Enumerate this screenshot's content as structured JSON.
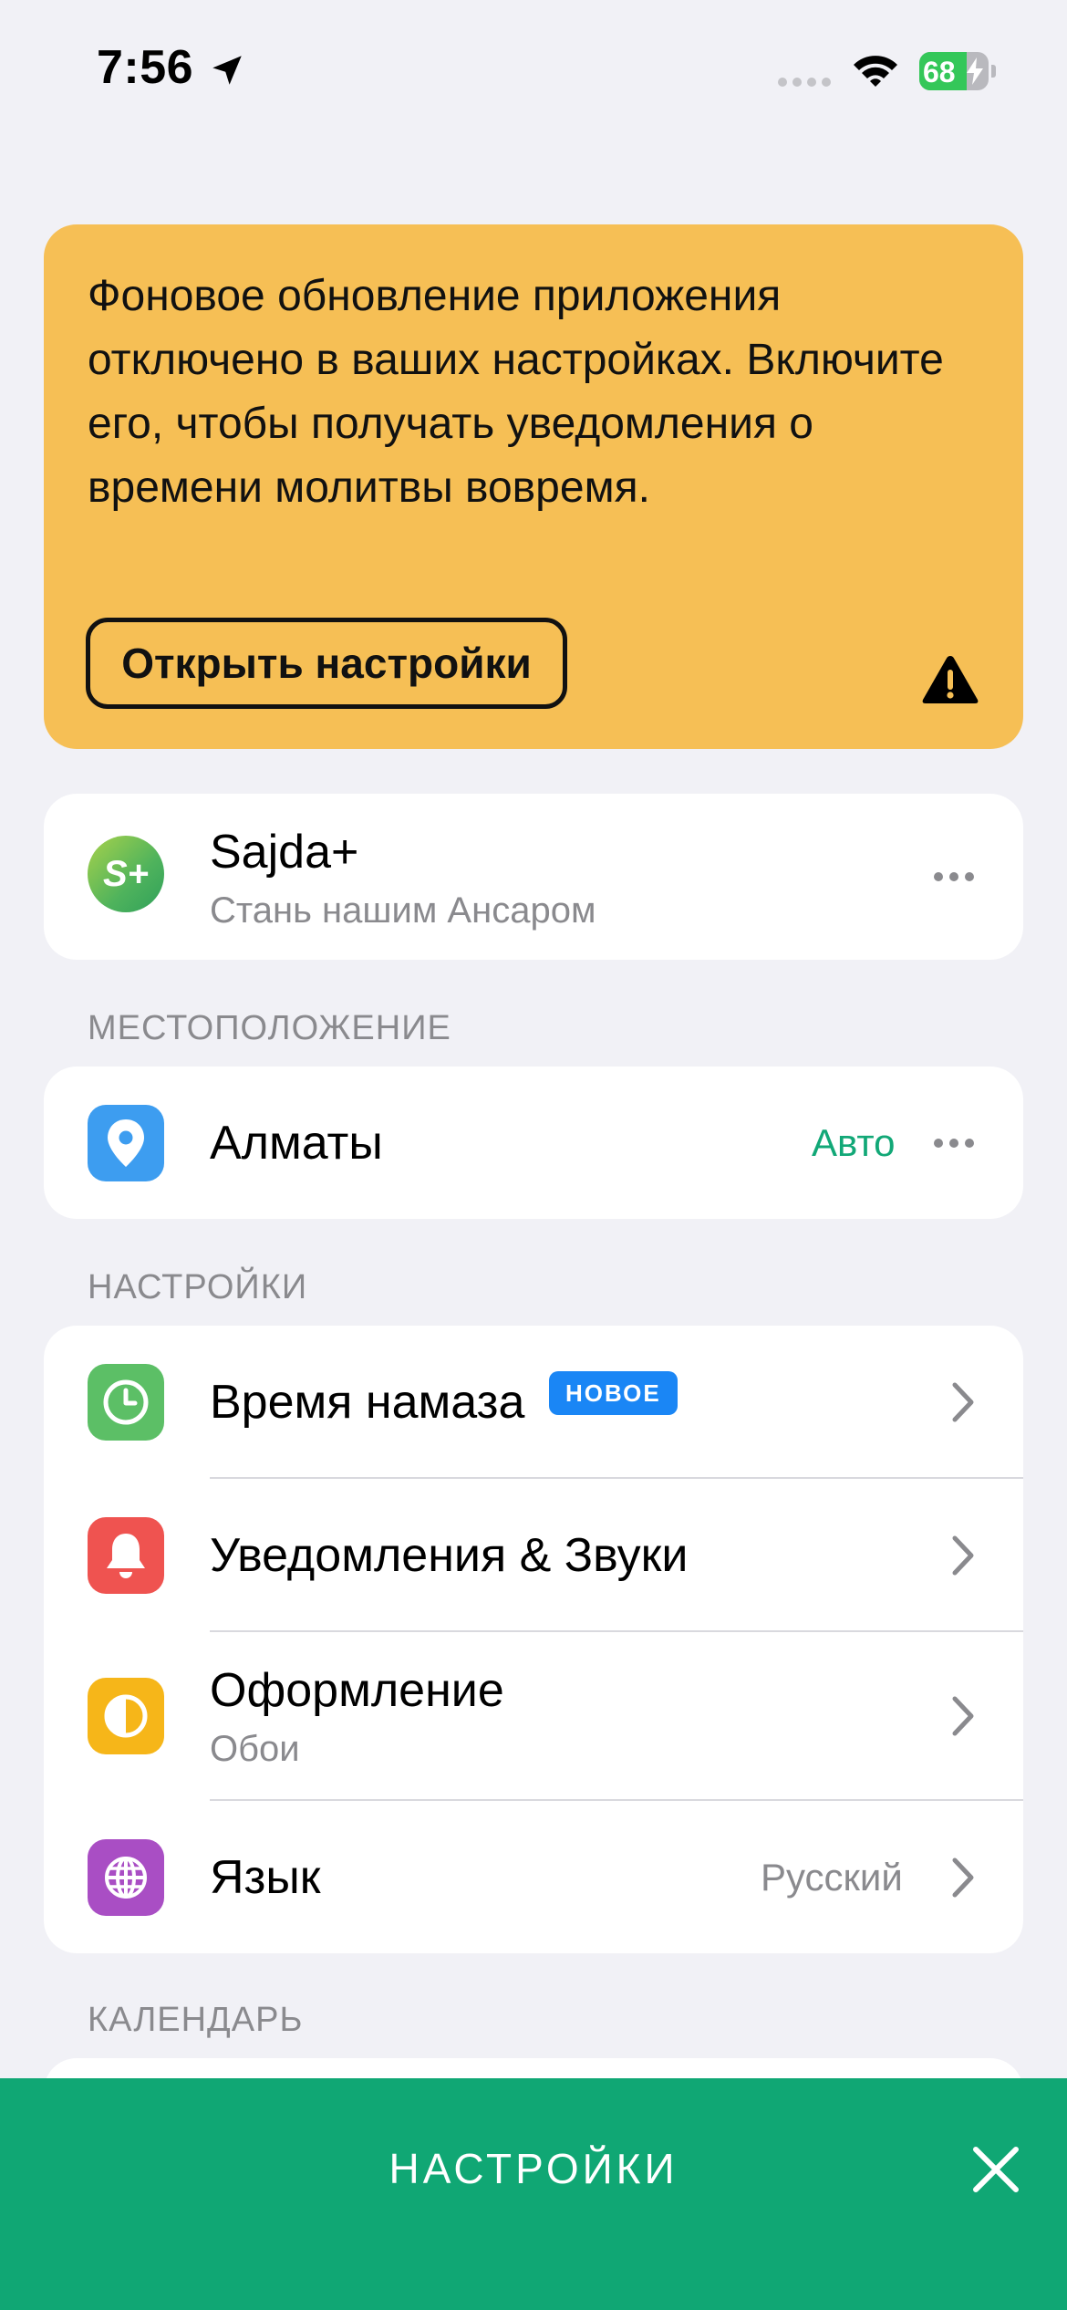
{
  "status_bar": {
    "time": "7:56",
    "battery": "68",
    "battery_level": 0.68
  },
  "warning": {
    "message": "Фоновое обновление приложения отключено в ваших настройках. Включите его, чтобы получать уведомления о времени молитвы вовремя.",
    "button_label": "Открыть настройки",
    "color": "#f6bf55",
    "icon": "warning-icon"
  },
  "sajda": {
    "logo_text": "S+",
    "title": "Sajda+",
    "subtitle": "Стань нашим Ансаром",
    "icon": "more-icon"
  },
  "location": {
    "header": "МЕСТОПОЛОЖЕНИЕ",
    "city": "Алматы",
    "mode": "Авто",
    "icon": "location-pin-icon"
  },
  "settings": {
    "header": "НАСТРОЙКИ",
    "items": [
      {
        "label": "Время намаза",
        "badge": "НОВОЕ",
        "icon": "clock-icon",
        "color": "#5cbf66"
      },
      {
        "label": "Уведомления & Звуки",
        "icon": "bell-icon",
        "color": "#ef5350"
      },
      {
        "label": "Оформление",
        "subtitle": "Обои",
        "icon": "appearance-icon",
        "color": "#f6b619"
      },
      {
        "label": "Язык",
        "value": "Русский",
        "icon": "globe-icon",
        "color": "#a94ec4"
      }
    ]
  },
  "calendar": {
    "header": "КАЛЕНДАРЬ"
  },
  "bottom_bar": {
    "title": "НАСТРОЙКИ",
    "color": "#10a774",
    "close_icon": "close-icon"
  }
}
